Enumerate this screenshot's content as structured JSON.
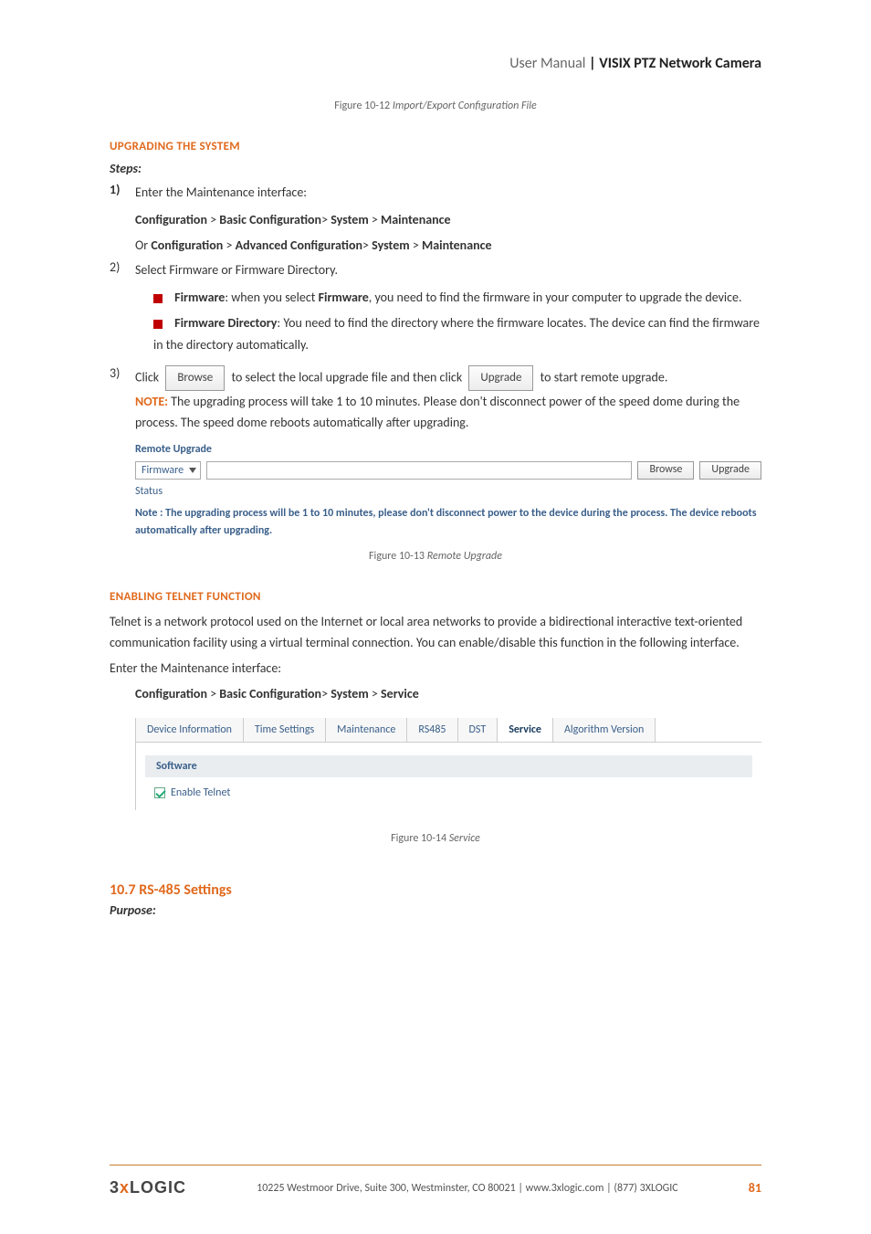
{
  "header": {
    "light": "User Manual",
    "sep": " | ",
    "bold": "VISIX PTZ Network Camera"
  },
  "fig1": {
    "prefix": "Figure 10-12 ",
    "title": "Import/Export Configuration File"
  },
  "sec1": {
    "title": "UPGRADING THE SYSTEM",
    "steps_label": "Steps:",
    "s1_num": "1)",
    "s1_text": "Enter the Maintenance interface:",
    "s1_path1_a": "Configuration",
    "s1_path1_b": "Basic Configuration",
    "s1_path1_c": "System",
    "s1_path1_d": "Maintenance",
    "s1_or": "Or ",
    "s1_path2_a": "Configuration",
    "s1_path2_b": "Advanced Configuration",
    "s1_path2_c": "System",
    "s1_path2_d": "Maintenance",
    "s2_num": "2)",
    "s2_text": "Select Firmware or Firmware Directory.",
    "s2_b1_t": "Firmware",
    "s2_b1_rest": ": when you select ",
    "s2_b1_t2": "Firmware",
    "s2_b1_rest2": ", you need to find the firmware in your computer to upgrade the device.",
    "s2_b2_t": "Firmware Directory",
    "s2_b2_rest": ": You need to find the directory where the firmware locates. The device can find the firmware in the directory automatically.",
    "s3_num": "3)",
    "s3_a": "Click ",
    "s3_btn_browse": "Browse",
    "s3_b": " to select the local upgrade file and then click ",
    "s3_btn_upgrade": "Upgrade",
    "s3_c": " to start remote upgrade.",
    "s3_note_label": "NOTE:",
    "s3_note_body": " The upgrading process will take 1 to 10 minutes. Please don't disconnect power of the speed dome during the process. The speed dome reboots automatically after upgrading."
  },
  "remote": {
    "title": "Remote Upgrade",
    "select": "Firmware",
    "browse": "Browse",
    "upgrade": "Upgrade",
    "status": "Status",
    "note_label": "Note :",
    "note_body": "  The upgrading process will be 1 to 10 minutes, please don't disconnect power to the device during the process. The device reboots automatically after upgrading."
  },
  "fig2": {
    "prefix": "Figure 10-13 ",
    "title": "Remote Upgrade"
  },
  "sec2": {
    "title": "ENABLING TELNET FUNCTION",
    "p1": "Telnet is a network protocol used on the Internet or local area networks to provide a bidirectional interactive text-oriented communication facility using a virtual terminal connection. You can enable/disable this function in the following interface.",
    "p2": "Enter the Maintenance interface:",
    "path_a": "Configuration",
    "path_b": "Basic Configuration",
    "path_c": "System",
    "path_d": "Service"
  },
  "tabs": {
    "t1": "Device Information",
    "t2": "Time Settings",
    "t3": "Maintenance",
    "t4": "RS485",
    "t5": "DST",
    "t6": "Service",
    "t7": "Algorithm Version"
  },
  "soft": {
    "header": "Software",
    "chk": "Enable Telnet"
  },
  "fig3": {
    "prefix": "Figure 10-14 ",
    "title": "Service"
  },
  "rs": {
    "num": "10.7",
    "title": " RS-485 Settings",
    "purpose": "Purpose:"
  },
  "footer": {
    "logo_a": "3",
    "logo_x": "x",
    "logo_b": "LOGIC",
    "text": "10225 Westmoor Drive, Suite 300, Westminster, CO 80021 | www.3xlogic.com | (877) 3XLOGIC",
    "page": "81"
  }
}
